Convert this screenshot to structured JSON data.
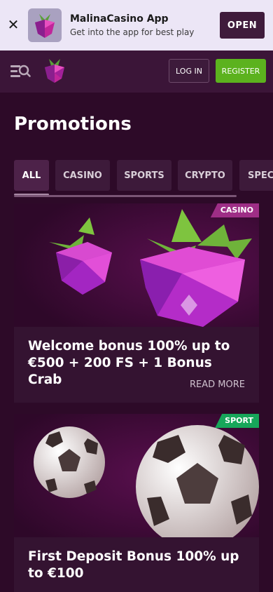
{
  "app_banner": {
    "title": "MalinaCasino App",
    "subtitle": "Get into the app for best play",
    "open_label": "OPEN",
    "close_icon": "close-icon"
  },
  "header": {
    "login_label": "LOG IN",
    "register_label": "REGISTER",
    "menu_icon": "menu-search-icon",
    "logo_icon": "raspberry-logo-icon"
  },
  "page": {
    "title": "Promotions"
  },
  "tabs": [
    {
      "label": "ALL",
      "active": true
    },
    {
      "label": "CASINO",
      "active": false
    },
    {
      "label": "SPORTS",
      "active": false
    },
    {
      "label": "CRYPTO",
      "active": false
    },
    {
      "label": "SPECI",
      "active": false
    }
  ],
  "promos": [
    {
      "badge": "CASINO",
      "title": "Welcome bonus 100% up to €500 + 200 FS + 1 Bonus Crab",
      "read_more": "READ MORE"
    },
    {
      "badge": "SPORT",
      "title": "First Deposit Bonus 100% up to €100"
    }
  ],
  "colors": {
    "background": "#2d0a28",
    "header": "#3b1538",
    "register": "#5cb21e",
    "casino_badge": "#9e2e86",
    "sport_badge": "#17a65a"
  }
}
